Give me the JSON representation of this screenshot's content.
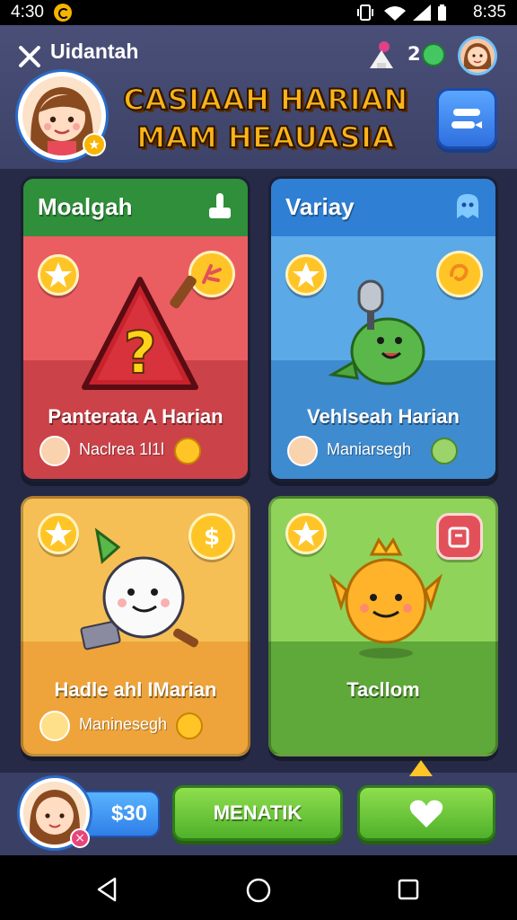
{
  "status_bar": {
    "time": "4:30",
    "clock": "8:35"
  },
  "header": {
    "username": "Uidantah",
    "count": "2",
    "title_line1": "CASIAAH HARIAN",
    "title_line2": "MAM HEAUASIA"
  },
  "cards": [
    {
      "header": "Moalgah",
      "label": "Panterata A Harian",
      "sub_text": "Naclrea 1l1l",
      "colors": {
        "head": "#2f8f3a",
        "body": "#e2515a"
      }
    },
    {
      "header": "Variay",
      "label": "Vehlseah Harian",
      "sub_text": "Maniarsegh",
      "colors": {
        "head": "#2f7fd4",
        "body": "#5ba9e6"
      }
    },
    {
      "header": "",
      "label": "Hadle ahl IMarian",
      "sub_text": "Maninesegh",
      "colors": {
        "body": "#f4b443"
      }
    },
    {
      "header": "",
      "label": "Tacllom",
      "sub_text": "",
      "colors": {
        "body": "#7fc94a"
      }
    }
  ],
  "bottom_bar": {
    "money": "$30",
    "primary_button": "MENATIK"
  },
  "icons": {
    "notification": "coin-notification-icon",
    "trophy": "trophy-icon",
    "gem": "gem-icon",
    "menu": "menu-icon",
    "star": "star-icon",
    "heart": "heart-icon",
    "nav_back": "triangle-back-icon",
    "nav_home": "circle-home-icon",
    "nav_recent": "square-recent-icon"
  }
}
